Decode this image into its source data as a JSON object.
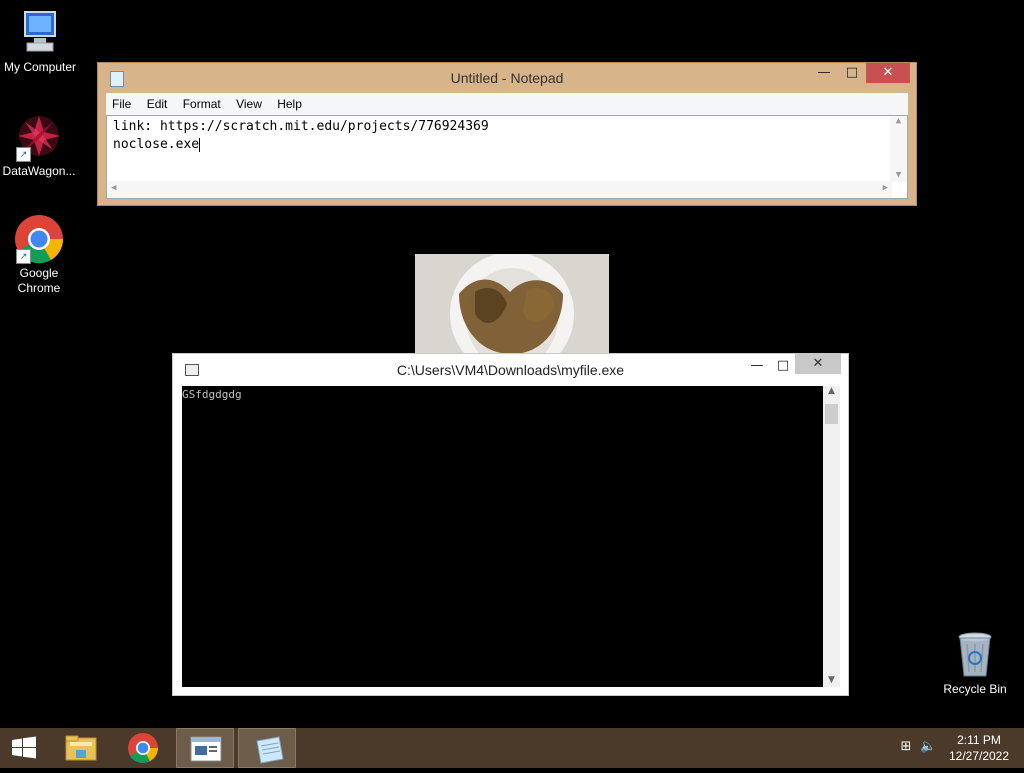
{
  "desktop": {
    "icons": [
      {
        "label": "My Computer"
      },
      {
        "label": "DataWagon..."
      },
      {
        "label": "Google Chrome"
      },
      {
        "label": "Recycle Bin"
      }
    ]
  },
  "notepad": {
    "title": "Untitled - Notepad",
    "menu": [
      "File",
      "Edit",
      "Format",
      "View",
      "Help"
    ],
    "lines": [
      "link: https://scratch.mit.edu/projects/776924369",
      "noclose.exe"
    ]
  },
  "console": {
    "title": "C:\\Users\\VM4\\Downloads\\myfile.exe",
    "output": "GSfdgdgdg"
  },
  "taskbar": {
    "time": "2:11 PM",
    "date": "12/27/2022"
  },
  "colors": {
    "notepad_frame": "#d7b48a",
    "taskbar": "#4b3a2a",
    "close_red": "#c75050"
  }
}
